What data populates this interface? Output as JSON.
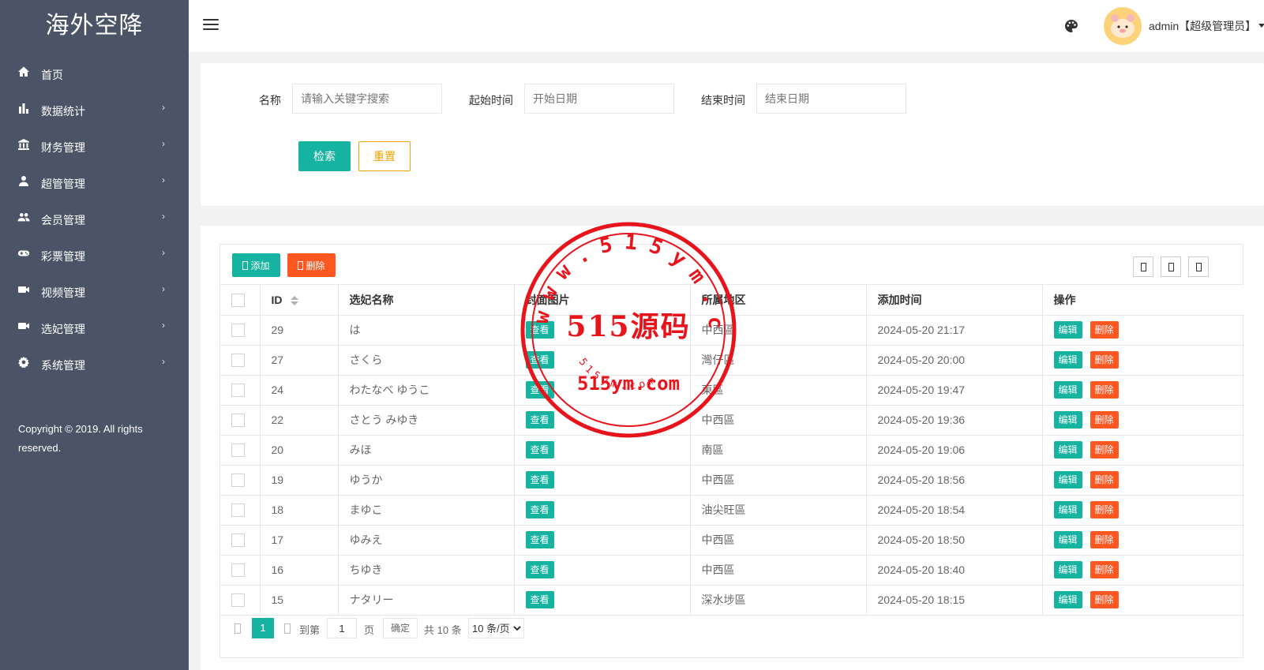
{
  "brand": "海外空降",
  "sidebar": {
    "items": [
      {
        "label": "首页",
        "icon": "home-icon",
        "has_children": false
      },
      {
        "label": "数据统计",
        "icon": "bar-chart-icon",
        "has_children": true
      },
      {
        "label": "财务管理",
        "icon": "bank-icon",
        "has_children": true
      },
      {
        "label": "超管管理",
        "icon": "user-icon",
        "has_children": true
      },
      {
        "label": "会员管理",
        "icon": "users-icon",
        "has_children": true
      },
      {
        "label": "彩票管理",
        "icon": "gamepad-icon",
        "has_children": true
      },
      {
        "label": "视频管理",
        "icon": "video-icon",
        "has_children": true
      },
      {
        "label": "选妃管理",
        "icon": "video-icon",
        "has_children": true
      },
      {
        "label": "系统管理",
        "icon": "gear-icon",
        "has_children": true
      }
    ],
    "copyright": "Copyright © 2019. All rights reserved."
  },
  "header": {
    "user": "admin【超级管理员】"
  },
  "search": {
    "name_label": "名称",
    "name_placeholder": "请输入关键字搜索",
    "start_label": "起始时间",
    "start_placeholder": "开始日期",
    "end_label": "结束时间",
    "end_placeholder": "结束日期",
    "search_button": "检索",
    "reset_button": "重置"
  },
  "toolbar": {
    "add_label": "添加",
    "delete_label": "删除"
  },
  "table": {
    "columns": [
      "ID",
      "选妃名称",
      "封面图片",
      "所属地区",
      "添加时间",
      "操作"
    ],
    "view_label": "查看",
    "edit_label": "编辑",
    "delete_label": "删除",
    "rows": [
      {
        "id": "29",
        "name": "は",
        "region": "中西區",
        "time": "2024-05-20 21:17"
      },
      {
        "id": "27",
        "name": "さくら",
        "region": "灣仔區",
        "time": "2024-05-20 20:00"
      },
      {
        "id": "24",
        "name": "わたなべ ゆうこ",
        "region": "東區",
        "time": "2024-05-20 19:47"
      },
      {
        "id": "22",
        "name": "さとう みゆき",
        "region": "中西區",
        "time": "2024-05-20 19:36"
      },
      {
        "id": "20",
        "name": "みほ",
        "region": "南區",
        "time": "2024-05-20 19:06"
      },
      {
        "id": "19",
        "name": "ゆうか",
        "region": "中西區",
        "time": "2024-05-20 18:56"
      },
      {
        "id": "18",
        "name": "まゆこ",
        "region": "油尖旺區",
        "time": "2024-05-20 18:54"
      },
      {
        "id": "17",
        "name": "ゆみえ",
        "region": "中西區",
        "time": "2024-05-20 18:50"
      },
      {
        "id": "16",
        "name": "ちゆき",
        "region": "中西區",
        "time": "2024-05-20 18:40"
      },
      {
        "id": "15",
        "name": "ナタリー",
        "region": "深水埗區",
        "time": "2024-05-20 18:15"
      }
    ]
  },
  "pagination": {
    "current": "1",
    "goto_label": "到第",
    "goto_value": "1",
    "page_label": "页",
    "confirm_label": "确定",
    "total_label": "共 10 条",
    "page_size": "10 条/页"
  },
  "watermark": {
    "main": "515源码",
    "url": "515ym.com",
    "ring_top": "www.515ym.com",
    "ring_bottom": "515ym.com",
    "color": "#e8141c"
  },
  "colors": {
    "sidebar_bg": "#4a5466",
    "primary": "#16b3a1",
    "danger": "#fd5722",
    "warning": "#f1a300"
  }
}
